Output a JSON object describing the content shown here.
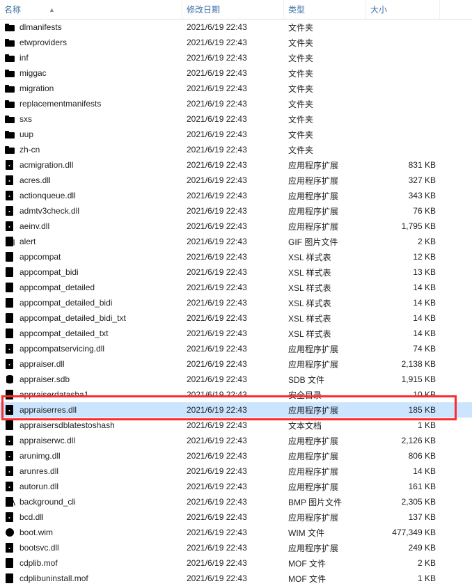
{
  "columns": {
    "name": "名称",
    "date": "修改日期",
    "type": "类型",
    "size": "大小"
  },
  "files": [
    {
      "icon": "folder",
      "name": "dlmanifests",
      "date": "2021/6/19 22:43",
      "type": "文件夹",
      "size": ""
    },
    {
      "icon": "folder",
      "name": "etwproviders",
      "date": "2021/6/19 22:43",
      "type": "文件夹",
      "size": ""
    },
    {
      "icon": "folder",
      "name": "inf",
      "date": "2021/6/19 22:43",
      "type": "文件夹",
      "size": ""
    },
    {
      "icon": "folder",
      "name": "miggac",
      "date": "2021/6/19 22:43",
      "type": "文件夹",
      "size": ""
    },
    {
      "icon": "folder",
      "name": "migration",
      "date": "2021/6/19 22:43",
      "type": "文件夹",
      "size": ""
    },
    {
      "icon": "folder",
      "name": "replacementmanifests",
      "date": "2021/6/19 22:43",
      "type": "文件夹",
      "size": ""
    },
    {
      "icon": "folder",
      "name": "sxs",
      "date": "2021/6/19 22:43",
      "type": "文件夹",
      "size": ""
    },
    {
      "icon": "folder",
      "name": "uup",
      "date": "2021/6/19 22:43",
      "type": "文件夹",
      "size": ""
    },
    {
      "icon": "folder",
      "name": "zh-cn",
      "date": "2021/6/19 22:43",
      "type": "文件夹",
      "size": ""
    },
    {
      "icon": "dll",
      "name": "acmigration.dll",
      "date": "2021/6/19 22:43",
      "type": "应用程序扩展",
      "size": "831 KB"
    },
    {
      "icon": "dll",
      "name": "acres.dll",
      "date": "2021/6/19 22:43",
      "type": "应用程序扩展",
      "size": "327 KB"
    },
    {
      "icon": "dll",
      "name": "actionqueue.dll",
      "date": "2021/6/19 22:43",
      "type": "应用程序扩展",
      "size": "343 KB"
    },
    {
      "icon": "dll",
      "name": "admtv3check.dll",
      "date": "2021/6/19 22:43",
      "type": "应用程序扩展",
      "size": "76 KB"
    },
    {
      "icon": "dll",
      "name": "aeinv.dll",
      "date": "2021/6/19 22:43",
      "type": "应用程序扩展",
      "size": "1,795 KB"
    },
    {
      "icon": "gif",
      "name": "alert",
      "date": "2021/6/19 22:43",
      "type": "GIF 图片文件",
      "size": "2 KB"
    },
    {
      "icon": "xsl",
      "name": "appcompat",
      "date": "2021/6/19 22:43",
      "type": "XSL 样式表",
      "size": "12 KB"
    },
    {
      "icon": "xsl",
      "name": "appcompat_bidi",
      "date": "2021/6/19 22:43",
      "type": "XSL 样式表",
      "size": "13 KB"
    },
    {
      "icon": "xsl",
      "name": "appcompat_detailed",
      "date": "2021/6/19 22:43",
      "type": "XSL 样式表",
      "size": "14 KB"
    },
    {
      "icon": "xsl",
      "name": "appcompat_detailed_bidi",
      "date": "2021/6/19 22:43",
      "type": "XSL 样式表",
      "size": "14 KB"
    },
    {
      "icon": "xsl",
      "name": "appcompat_detailed_bidi_txt",
      "date": "2021/6/19 22:43",
      "type": "XSL 样式表",
      "size": "14 KB"
    },
    {
      "icon": "xsl",
      "name": "appcompat_detailed_txt",
      "date": "2021/6/19 22:43",
      "type": "XSL 样式表",
      "size": "14 KB"
    },
    {
      "icon": "dll",
      "name": "appcompatservicing.dll",
      "date": "2021/6/19 22:43",
      "type": "应用程序扩展",
      "size": "74 KB"
    },
    {
      "icon": "dll",
      "name": "appraiser.dll",
      "date": "2021/6/19 22:43",
      "type": "应用程序扩展",
      "size": "2,138 KB"
    },
    {
      "icon": "db",
      "name": "appraiser.sdb",
      "date": "2021/6/19 22:43",
      "type": "SDB 文件",
      "size": "1,915 KB"
    },
    {
      "icon": "cat",
      "name": "appraiserdatasha1",
      "date": "2021/6/19 22:43",
      "type": "安全目录",
      "size": "10 KB"
    },
    {
      "icon": "dll",
      "name": "appraiserres.dll",
      "date": "2021/6/19 22:43",
      "type": "应用程序扩展",
      "size": "185 KB",
      "selected": true
    },
    {
      "icon": "file",
      "name": "appraisersdblatestoshash",
      "date": "2021/6/19 22:43",
      "type": "文本文档",
      "size": "1 KB"
    },
    {
      "icon": "dll",
      "name": "appraiserwc.dll",
      "date": "2021/6/19 22:43",
      "type": "应用程序扩展",
      "size": "2,126 KB"
    },
    {
      "icon": "dll",
      "name": "arunimg.dll",
      "date": "2021/6/19 22:43",
      "type": "应用程序扩展",
      "size": "806 KB"
    },
    {
      "icon": "dll",
      "name": "arunres.dll",
      "date": "2021/6/19 22:43",
      "type": "应用程序扩展",
      "size": "14 KB"
    },
    {
      "icon": "dll",
      "name": "autorun.dll",
      "date": "2021/6/19 22:43",
      "type": "应用程序扩展",
      "size": "161 KB"
    },
    {
      "icon": "bmp",
      "name": "background_cli",
      "date": "2021/6/19 22:43",
      "type": "BMP 图片文件",
      "size": "2,305 KB"
    },
    {
      "icon": "dll",
      "name": "bcd.dll",
      "date": "2021/6/19 22:43",
      "type": "应用程序扩展",
      "size": "137 KB"
    },
    {
      "icon": "wim",
      "name": "boot.wim",
      "date": "2021/6/19 22:43",
      "type": "WIM 文件",
      "size": "477,349 KB"
    },
    {
      "icon": "dll",
      "name": "bootsvc.dll",
      "date": "2021/6/19 22:43",
      "type": "应用程序扩展",
      "size": "249 KB"
    },
    {
      "icon": "file",
      "name": "cdplib.mof",
      "date": "2021/6/19 22:43",
      "type": "MOF 文件",
      "size": "2 KB"
    },
    {
      "icon": "file",
      "name": "cdplibuninstall.mof",
      "date": "2021/6/19 22:43",
      "type": "MOF 文件",
      "size": "1 KB"
    }
  ],
  "highlight": {
    "row_index": 25
  }
}
